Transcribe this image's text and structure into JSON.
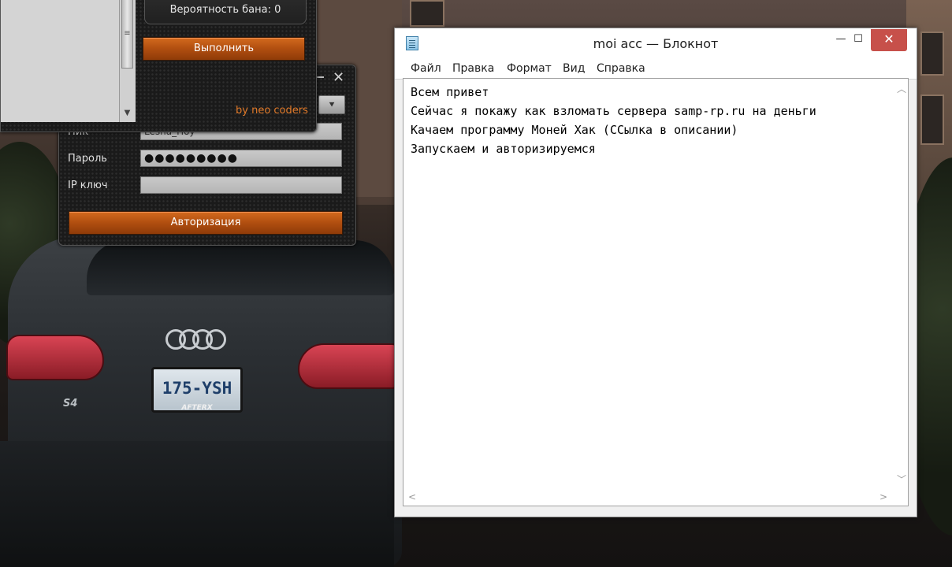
{
  "tool_main": {
    "ban_probability": "Вероятность бана: 0",
    "execute_label": "Выполнить",
    "credit": "by neo coders"
  },
  "tool_login": {
    "nick_label": "Ник",
    "nick_value": "Lesha_Hoy",
    "password_label": "Пароль",
    "password_value": "●●●●●●●●●",
    "ipkey_label": "IP ключ",
    "ipkey_value": "",
    "auth_label": "Авторизация"
  },
  "notepad": {
    "title": "moi acc — Блокнот",
    "menu": [
      "Файл",
      "Правка",
      "Формат",
      "Вид",
      "Справка"
    ],
    "lines": [
      "Всем привет",
      "Сейчас я покажу как взломать сервера samp-rp.ru на деньги",
      "Качаем программу Моней Хак (ССылка в описании)",
      "Запускаем и авторизируемся"
    ]
  },
  "wallpaper": {
    "plate": "175-YSH",
    "plate_frame": "AFTERX",
    "badge": "S4"
  },
  "colors": {
    "orange_button": "#b04e10",
    "credit_text": "#e37b2a",
    "close_red": "#c7504a"
  }
}
